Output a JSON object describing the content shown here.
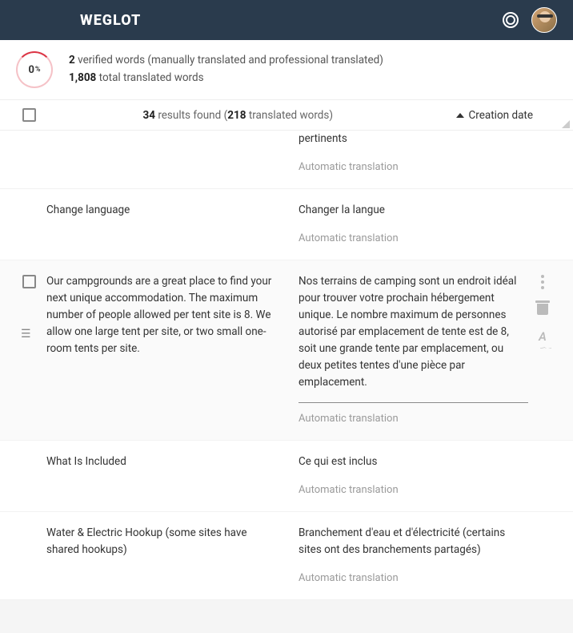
{
  "header": {
    "logo": "WEGLOT"
  },
  "stats": {
    "percent_value": "0",
    "percent_sign": "%",
    "verified_count": "2",
    "verified_label": "verified words (manually translated and professional translated)",
    "total_count": "1,808",
    "total_label": "total translated words"
  },
  "results": {
    "count": "34",
    "count_label": "results found (",
    "words": "218",
    "words_label": "translated words)",
    "sort_label": "Creation date"
  },
  "rows": [
    {
      "source": "",
      "target": "pertinents",
      "type_label": "Automatic translation",
      "partial_top": true,
      "show_check": false,
      "show_actions": false,
      "target_line": false
    },
    {
      "source": "Change language",
      "target": "Changer la langue",
      "type_label": "Automatic translation",
      "partial_top": false,
      "show_check": false,
      "show_actions": false,
      "target_line": false
    },
    {
      "source": "Our campgrounds are a great place to find your next unique accommodation. The maximum number of people allowed per tent site is 8. We allow one large tent per site, or two small one-room tents per site.",
      "target": "Nos terrains de camping sont un endroit idéal pour trouver votre prochain hébergement unique. Le nombre maximum de personnes autorisé par emplacement de tente est de 8, soit une grande tente par emplacement, ou deux petites tentes d'une pièce par emplacement.",
      "type_label": "Automatic translation",
      "partial_top": false,
      "show_check": true,
      "show_actions": true,
      "target_line": true,
      "alt_bg": true,
      "drag_handle": true
    },
    {
      "source": "What Is Included",
      "target": "Ce qui est inclus",
      "type_label": "Automatic translation",
      "partial_top": false,
      "show_check": false,
      "show_actions": false,
      "target_line": false
    },
    {
      "source": "Water & Electric Hookup (some sites have shared hookups)",
      "target": "Branchement d'eau et d'électricité (certains sites ont des branchements partagés)",
      "type_label": "Automatic translation",
      "partial_top": false,
      "show_check": false,
      "show_actions": false,
      "target_line": false
    }
  ]
}
